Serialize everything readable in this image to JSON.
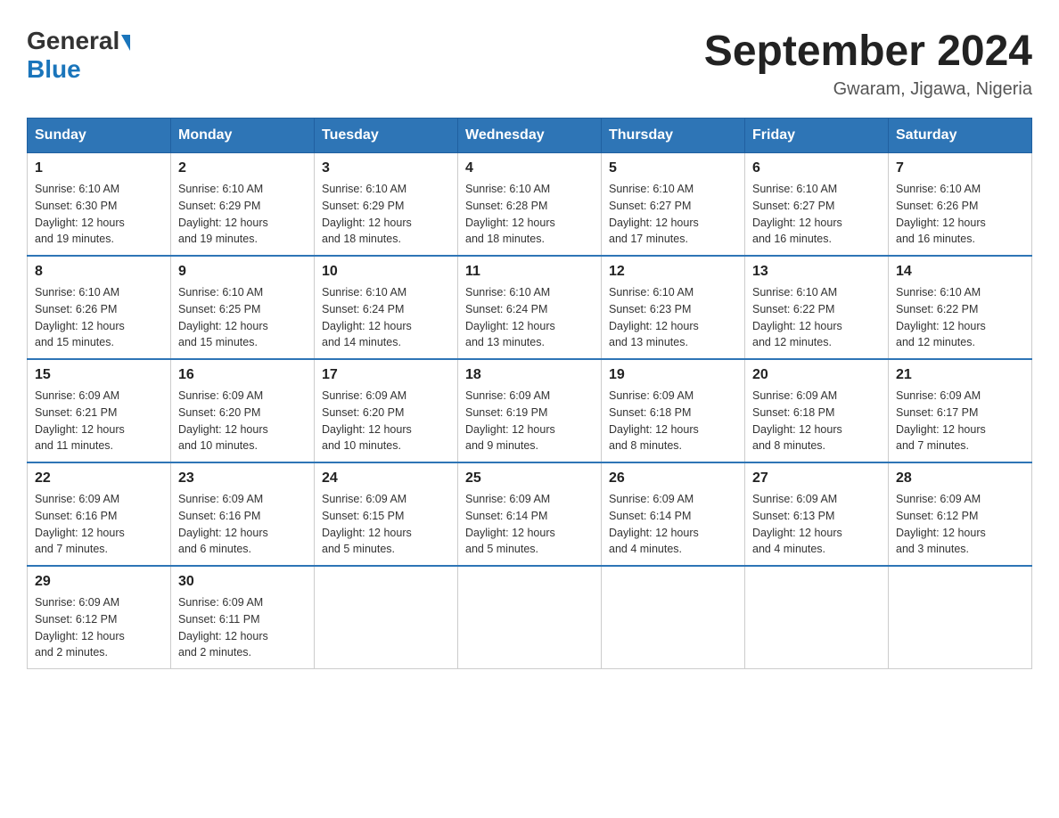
{
  "header": {
    "logo_general": "General",
    "logo_blue": "Blue",
    "title": "September 2024",
    "subtitle": "Gwaram, Jigawa, Nigeria"
  },
  "days_of_week": [
    "Sunday",
    "Monday",
    "Tuesday",
    "Wednesday",
    "Thursday",
    "Friday",
    "Saturday"
  ],
  "weeks": [
    [
      {
        "day": "1",
        "sunrise": "6:10 AM",
        "sunset": "6:30 PM",
        "daylight": "12 hours and 19 minutes."
      },
      {
        "day": "2",
        "sunrise": "6:10 AM",
        "sunset": "6:29 PM",
        "daylight": "12 hours and 19 minutes."
      },
      {
        "day": "3",
        "sunrise": "6:10 AM",
        "sunset": "6:29 PM",
        "daylight": "12 hours and 18 minutes."
      },
      {
        "day": "4",
        "sunrise": "6:10 AM",
        "sunset": "6:28 PM",
        "daylight": "12 hours and 18 minutes."
      },
      {
        "day": "5",
        "sunrise": "6:10 AM",
        "sunset": "6:27 PM",
        "daylight": "12 hours and 17 minutes."
      },
      {
        "day": "6",
        "sunrise": "6:10 AM",
        "sunset": "6:27 PM",
        "daylight": "12 hours and 16 minutes."
      },
      {
        "day": "7",
        "sunrise": "6:10 AM",
        "sunset": "6:26 PM",
        "daylight": "12 hours and 16 minutes."
      }
    ],
    [
      {
        "day": "8",
        "sunrise": "6:10 AM",
        "sunset": "6:26 PM",
        "daylight": "12 hours and 15 minutes."
      },
      {
        "day": "9",
        "sunrise": "6:10 AM",
        "sunset": "6:25 PM",
        "daylight": "12 hours and 15 minutes."
      },
      {
        "day": "10",
        "sunrise": "6:10 AM",
        "sunset": "6:24 PM",
        "daylight": "12 hours and 14 minutes."
      },
      {
        "day": "11",
        "sunrise": "6:10 AM",
        "sunset": "6:24 PM",
        "daylight": "12 hours and 13 minutes."
      },
      {
        "day": "12",
        "sunrise": "6:10 AM",
        "sunset": "6:23 PM",
        "daylight": "12 hours and 13 minutes."
      },
      {
        "day": "13",
        "sunrise": "6:10 AM",
        "sunset": "6:22 PM",
        "daylight": "12 hours and 12 minutes."
      },
      {
        "day": "14",
        "sunrise": "6:10 AM",
        "sunset": "6:22 PM",
        "daylight": "12 hours and 12 minutes."
      }
    ],
    [
      {
        "day": "15",
        "sunrise": "6:09 AM",
        "sunset": "6:21 PM",
        "daylight": "12 hours and 11 minutes."
      },
      {
        "day": "16",
        "sunrise": "6:09 AM",
        "sunset": "6:20 PM",
        "daylight": "12 hours and 10 minutes."
      },
      {
        "day": "17",
        "sunrise": "6:09 AM",
        "sunset": "6:20 PM",
        "daylight": "12 hours and 10 minutes."
      },
      {
        "day": "18",
        "sunrise": "6:09 AM",
        "sunset": "6:19 PM",
        "daylight": "12 hours and 9 minutes."
      },
      {
        "day": "19",
        "sunrise": "6:09 AM",
        "sunset": "6:18 PM",
        "daylight": "12 hours and 8 minutes."
      },
      {
        "day": "20",
        "sunrise": "6:09 AM",
        "sunset": "6:18 PM",
        "daylight": "12 hours and 8 minutes."
      },
      {
        "day": "21",
        "sunrise": "6:09 AM",
        "sunset": "6:17 PM",
        "daylight": "12 hours and 7 minutes."
      }
    ],
    [
      {
        "day": "22",
        "sunrise": "6:09 AM",
        "sunset": "6:16 PM",
        "daylight": "12 hours and 7 minutes."
      },
      {
        "day": "23",
        "sunrise": "6:09 AM",
        "sunset": "6:16 PM",
        "daylight": "12 hours and 6 minutes."
      },
      {
        "day": "24",
        "sunrise": "6:09 AM",
        "sunset": "6:15 PM",
        "daylight": "12 hours and 5 minutes."
      },
      {
        "day": "25",
        "sunrise": "6:09 AM",
        "sunset": "6:14 PM",
        "daylight": "12 hours and 5 minutes."
      },
      {
        "day": "26",
        "sunrise": "6:09 AM",
        "sunset": "6:14 PM",
        "daylight": "12 hours and 4 minutes."
      },
      {
        "day": "27",
        "sunrise": "6:09 AM",
        "sunset": "6:13 PM",
        "daylight": "12 hours and 4 minutes."
      },
      {
        "day": "28",
        "sunrise": "6:09 AM",
        "sunset": "6:12 PM",
        "daylight": "12 hours and 3 minutes."
      }
    ],
    [
      {
        "day": "29",
        "sunrise": "6:09 AM",
        "sunset": "6:12 PM",
        "daylight": "12 hours and 2 minutes."
      },
      {
        "day": "30",
        "sunrise": "6:09 AM",
        "sunset": "6:11 PM",
        "daylight": "12 hours and 2 minutes."
      },
      null,
      null,
      null,
      null,
      null
    ]
  ],
  "labels": {
    "sunrise": "Sunrise:",
    "sunset": "Sunset:",
    "daylight": "Daylight:"
  }
}
